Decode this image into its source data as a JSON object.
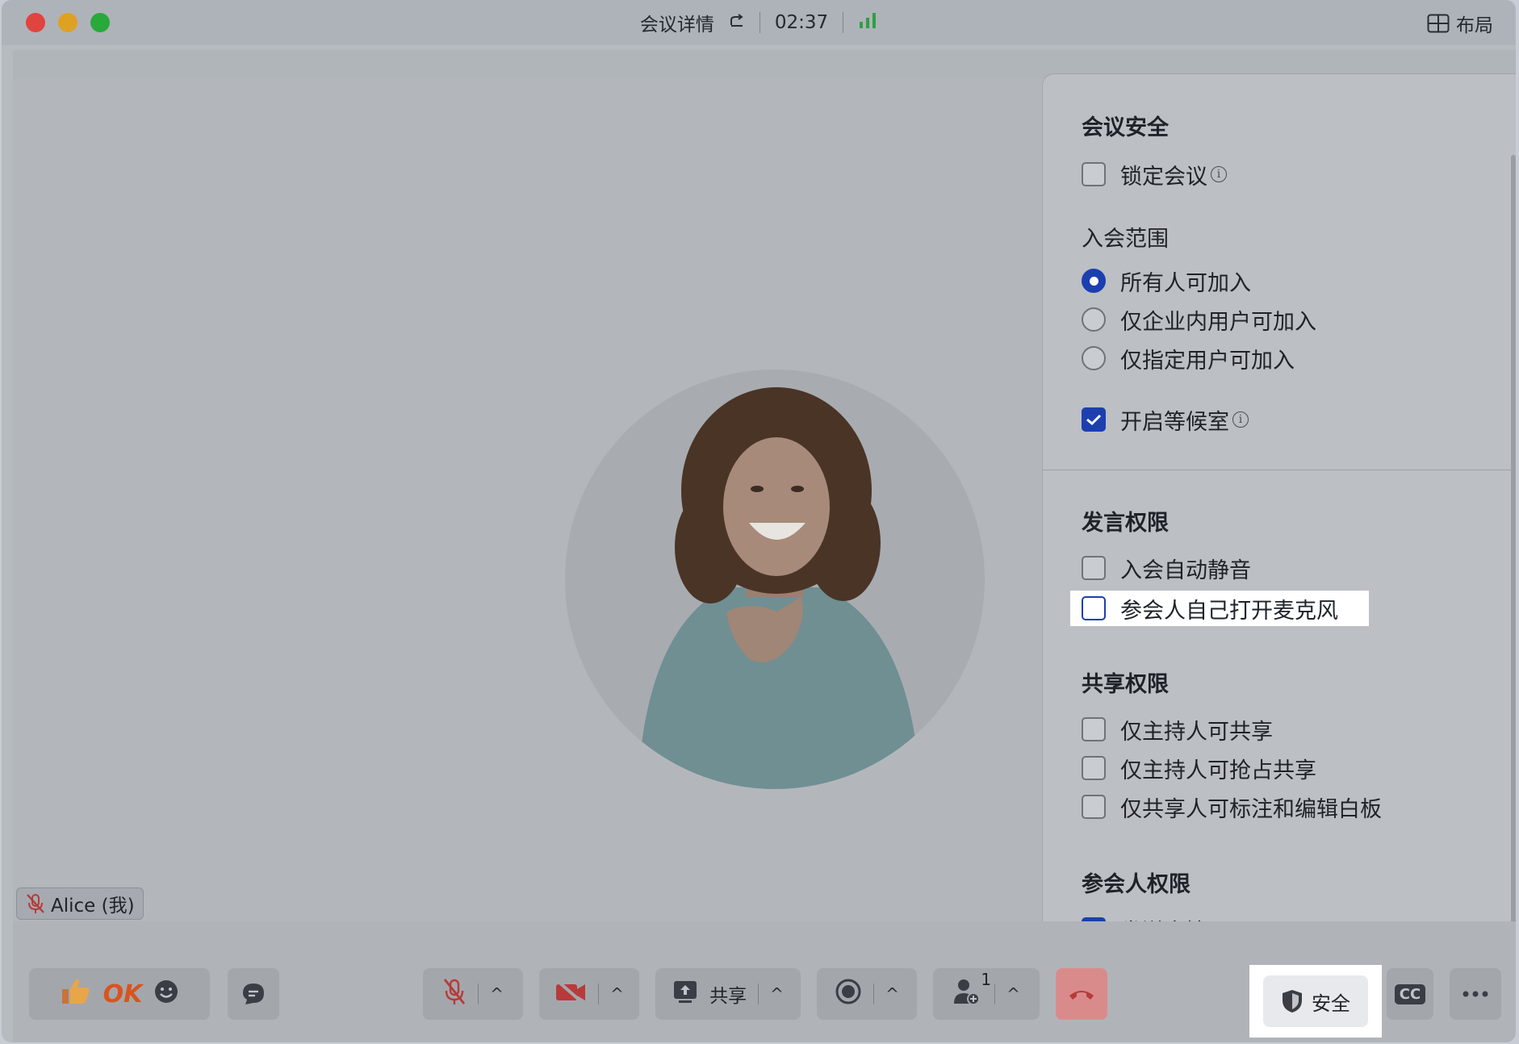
{
  "titlebar": {
    "title": "会议详情",
    "timer": "02:37",
    "layout_label": "布局"
  },
  "participant": {
    "name": "Alice (我)"
  },
  "security_panel": {
    "meeting_security": {
      "title": "会议安全",
      "lock_meeting": {
        "label": "锁定会议",
        "checked": false
      }
    },
    "join_scope": {
      "title": "入会范围",
      "options": [
        {
          "label": "所有人可加入",
          "selected": true
        },
        {
          "label": "仅企业内用户可加入",
          "selected": false
        },
        {
          "label": "仅指定用户可加入",
          "selected": false
        }
      ],
      "waiting_room": {
        "label": "开启等候室",
        "checked": true
      }
    },
    "speak_permissions": {
      "title": "发言权限",
      "mute_on_join": {
        "label": "入会自动静音",
        "checked": false
      },
      "self_unmute": {
        "label": "参会人自己打开麦克风",
        "checked": false
      }
    },
    "share_permissions": {
      "title": "共享权限",
      "items": [
        {
          "label": "仅主持人可共享",
          "checked": false
        },
        {
          "label": "仅主持人可抢占共享",
          "checked": false
        },
        {
          "label": "仅共享人可标注和编辑白板",
          "checked": false
        }
      ]
    },
    "participant_permissions": {
      "title": "参会人权限",
      "send_reactions": {
        "label": "发送表情",
        "checked": true
      }
    }
  },
  "toolbar": {
    "ok_label": "OK",
    "share_label": "共享",
    "participants_count": "1",
    "security_label": "安全",
    "cc_label": "CC"
  },
  "colors": {
    "accent": "#1c3fb0",
    "hangup": "#e56b6b",
    "signal": "#2ea043"
  }
}
